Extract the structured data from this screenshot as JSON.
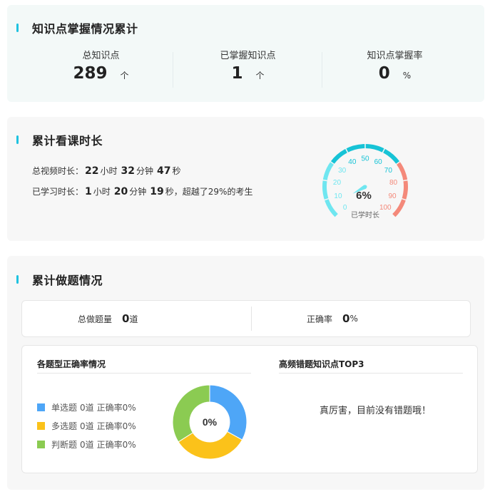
{
  "mastery": {
    "title": "知识点掌握情况累计",
    "stats": [
      {
        "label": "总知识点",
        "value": "289",
        "unit": "个"
      },
      {
        "label": "已掌握知识点",
        "value": "1",
        "unit": "个"
      },
      {
        "label": "知识点掌握率",
        "value": "0",
        "unit": "%"
      }
    ]
  },
  "watch": {
    "title": "累计看课时长",
    "total": {
      "label": "总视频时长：",
      "hours": "22",
      "hours_unit": "小时",
      "minutes": "32",
      "minutes_unit": "分钟",
      "seconds": "47",
      "seconds_unit": "秒"
    },
    "studied": {
      "label": "已学习时长：",
      "hours": "1",
      "hours_unit": "小时",
      "minutes": "20",
      "minutes_unit": "分钟",
      "seconds": "19",
      "seconds_unit": "秒",
      "beat": "，超越了29%的考生"
    },
    "gauge": {
      "value_text": "6%",
      "value": 6,
      "caption": "已学时长",
      "ticks": [
        "0",
        "10",
        "20",
        "30",
        "40",
        "50",
        "60",
        "70",
        "80",
        "90",
        "100"
      ],
      "colors": {
        "low": "#6fe6f0",
        "mid": "#17c3d6",
        "high": "#f4897a",
        "needle": "#6fe6f0"
      }
    }
  },
  "exercise": {
    "title": "累计做题情况",
    "total": {
      "label": "总做题量",
      "value": "0",
      "unit": "道"
    },
    "accuracy": {
      "label": "正确率",
      "value": "0",
      "unit": "%"
    },
    "by_type": {
      "heading": "各题型正确率情况",
      "legend": [
        {
          "name": "单选题",
          "count": "0道",
          "rate": "正确率0%",
          "color": "#4ea6f7"
        },
        {
          "name": "多选题",
          "count": "0道",
          "rate": "正确率0%",
          "color": "#fbc21a"
        },
        {
          "name": "判断题",
          "count": "0道",
          "rate": "正确率0%",
          "color": "#8bcb52"
        }
      ],
      "donut_center": "0%"
    },
    "top3": {
      "heading": "高频错题知识点TOP3",
      "empty_text": "真厉害，目前没有错题哦！"
    }
  }
}
